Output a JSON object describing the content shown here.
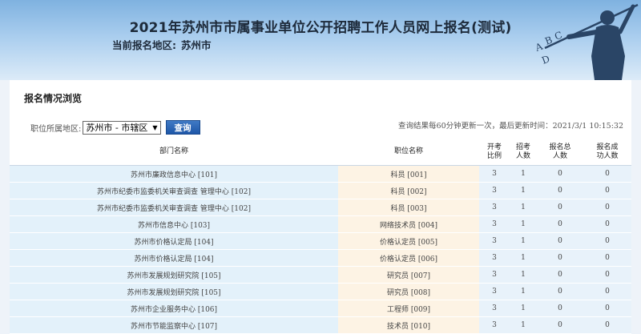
{
  "header": {
    "title": "2021年苏州市市属事业单位公开招聘工作人员网上报名(测试)",
    "region_label": "当前报名地区:",
    "region_value": "苏州市",
    "deco_letters": [
      "A",
      "B",
      "C",
      "D"
    ]
  },
  "panel": {
    "title": "报名情况浏览",
    "filter_label": "职位所属地区:",
    "select_value": "苏州市 - 市辖区",
    "query_button": "查询",
    "update_note": "查询结果每60分钟更新一次，最后更新时间：2021/3/1 10:15:32"
  },
  "table": {
    "headers": {
      "dept": "部门名称",
      "position": "职位名称",
      "ratio_1": "开考",
      "ratio_2": "比例",
      "plan_1": "招考",
      "plan_2": "人数",
      "total_1": "报名总",
      "total_2": "人数",
      "success_1": "报名成",
      "success_2": "功人数"
    },
    "rows": [
      {
        "dept": "苏州市廉政信息中心 [101]",
        "position": "科员 [001]",
        "ratio": "3",
        "plan": "1",
        "total": "0",
        "success": "0"
      },
      {
        "dept": "苏州市纪委市监委机关审查调查 管理中心 [102]",
        "position": "科员 [002]",
        "ratio": "3",
        "plan": "1",
        "total": "0",
        "success": "0"
      },
      {
        "dept": "苏州市纪委市监委机关审查调查 管理中心 [102]",
        "position": "科员 [003]",
        "ratio": "3",
        "plan": "1",
        "total": "0",
        "success": "0"
      },
      {
        "dept": "苏州市信息中心 [103]",
        "position": "网络技术员 [004]",
        "ratio": "3",
        "plan": "1",
        "total": "0",
        "success": "0"
      },
      {
        "dept": "苏州市价格认定局 [104]",
        "position": "价格认定员 [005]",
        "ratio": "3",
        "plan": "1",
        "total": "0",
        "success": "0"
      },
      {
        "dept": "苏州市价格认定局 [104]",
        "position": "价格认定员 [006]",
        "ratio": "3",
        "plan": "1",
        "total": "0",
        "success": "0"
      },
      {
        "dept": "苏州市发展规划研究院 [105]",
        "position": "研究员 [007]",
        "ratio": "3",
        "plan": "1",
        "total": "0",
        "success": "0"
      },
      {
        "dept": "苏州市发展规划研究院 [105]",
        "position": "研究员 [008]",
        "ratio": "3",
        "plan": "1",
        "total": "0",
        "success": "0"
      },
      {
        "dept": "苏州市企业服务中心 [106]",
        "position": "工程师 [009]",
        "ratio": "3",
        "plan": "1",
        "total": "0",
        "success": "0"
      },
      {
        "dept": "苏州市节能监察中心 [107]",
        "position": "技术员 [010]",
        "ratio": "3",
        "plan": "1",
        "total": "0",
        "success": "0"
      }
    ]
  }
}
